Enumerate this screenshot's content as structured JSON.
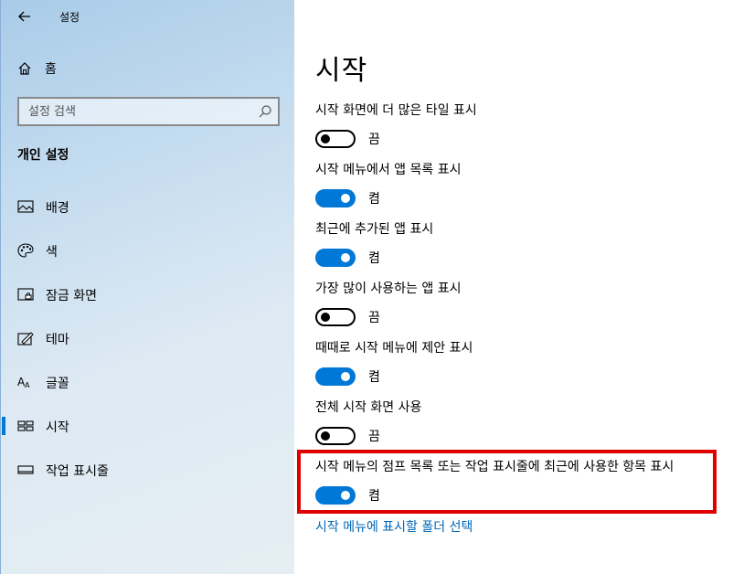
{
  "window": {
    "title": "설정"
  },
  "sidebar": {
    "home_label": "홈",
    "search_placeholder": "설정 검색",
    "section_title": "개인 설정",
    "items": [
      {
        "label": "배경",
        "icon": "image-icon"
      },
      {
        "label": "색",
        "icon": "palette-icon"
      },
      {
        "label": "잠금 화면",
        "icon": "lock-screen-icon"
      },
      {
        "label": "테마",
        "icon": "theme-icon"
      },
      {
        "label": "글꼴",
        "icon": "font-icon"
      },
      {
        "label": "시작",
        "icon": "start-icon",
        "active": true
      },
      {
        "label": "작업 표시줄",
        "icon": "taskbar-icon"
      }
    ]
  },
  "main": {
    "title": "시작",
    "settings": [
      {
        "label": "시작 화면에 더 많은 타일 표시",
        "state": "끔",
        "on": false
      },
      {
        "label": "시작 메뉴에서 앱 목록 표시",
        "state": "켬",
        "on": true
      },
      {
        "label": "최근에 추가된 앱 표시",
        "state": "켬",
        "on": true
      },
      {
        "label": "가장 많이 사용하는 앱 표시",
        "state": "끔",
        "on": false
      },
      {
        "label": "때때로 시작 메뉴에 제안 표시",
        "state": "켬",
        "on": true
      },
      {
        "label": "전체 시작 화면 사용",
        "state": "끔",
        "on": false
      },
      {
        "label": "시작 메뉴의 점프 목록 또는 작업 표시줄에 최근에 사용한 항목 표시",
        "state": "켬",
        "on": true
      }
    ],
    "link_label": "시작 메뉴에 표시할 폴더 선택"
  },
  "colors": {
    "accent": "#0078d7",
    "highlight": "#e00000",
    "link": "#0067b8"
  }
}
